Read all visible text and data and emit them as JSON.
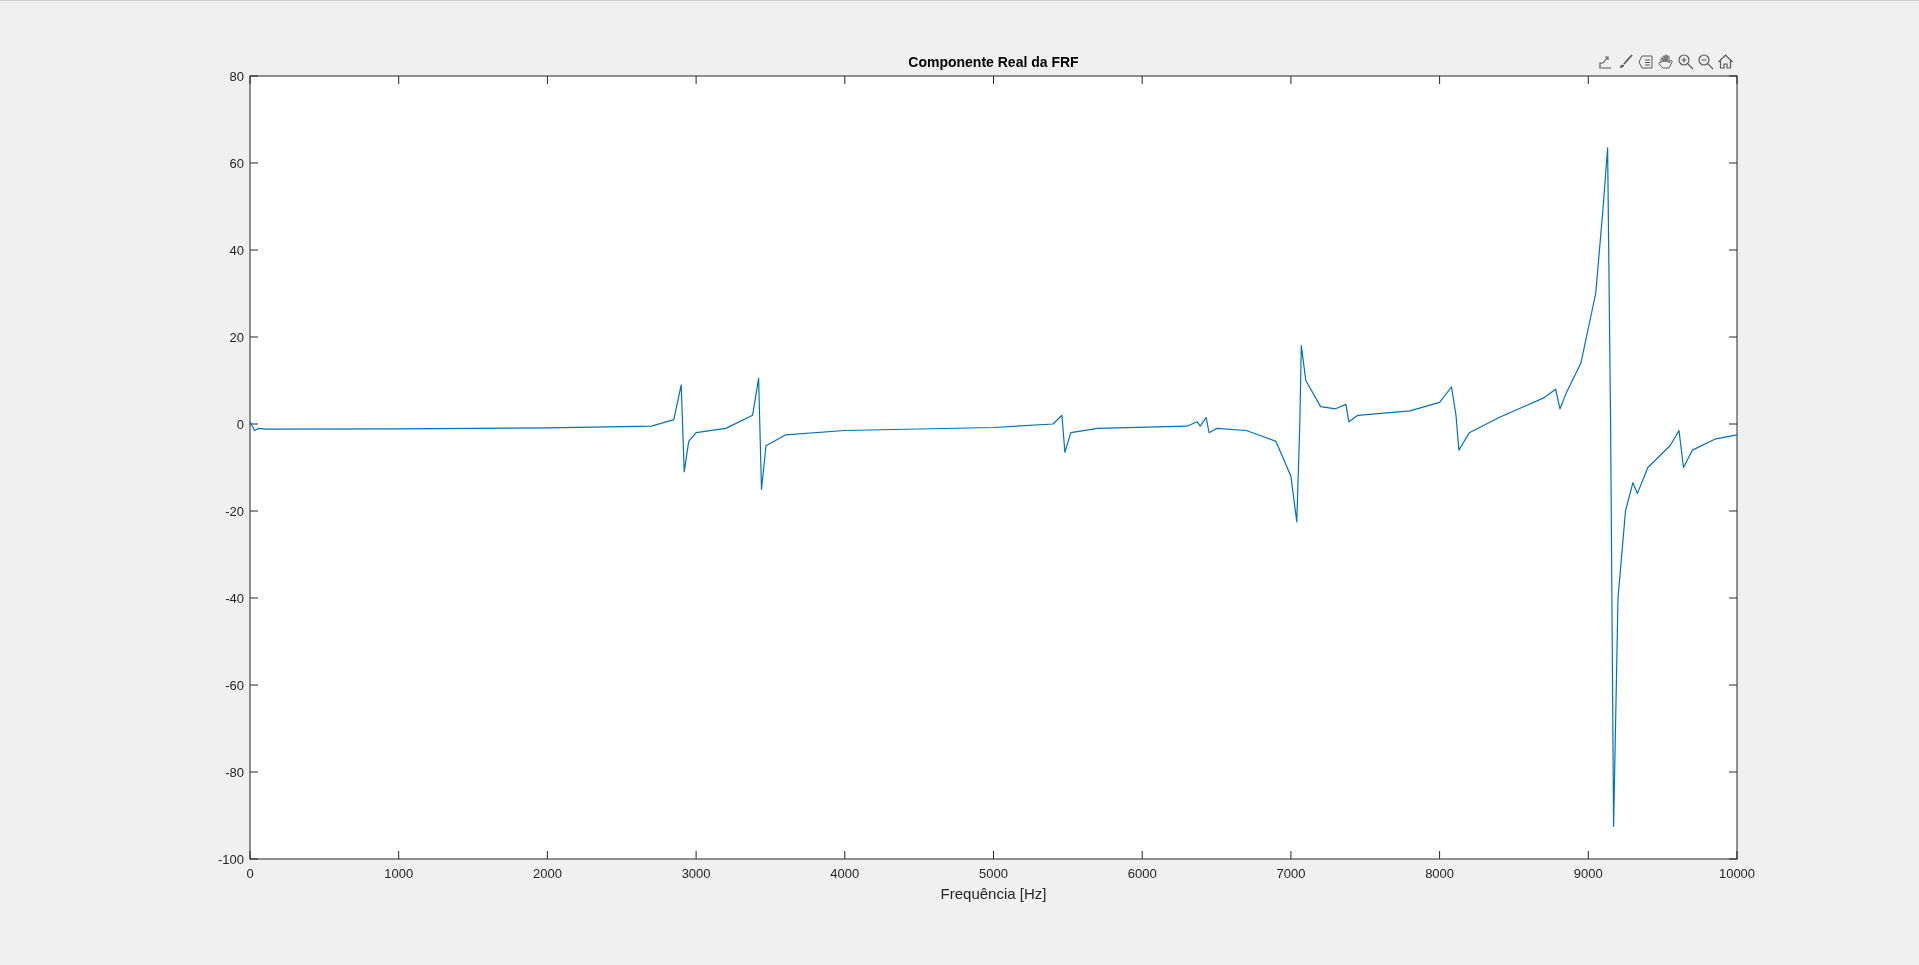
{
  "figure": {
    "chart_data": {
      "type": "line",
      "title": "Componente Real da FRF",
      "xlabel": "Frequência [Hz]",
      "x": [
        0,
        30,
        60,
        100,
        1000,
        2000,
        2700,
        2850,
        2900,
        2920,
        2950,
        3000,
        3200,
        3380,
        3420,
        3440,
        3470,
        3600,
        4000,
        5000,
        5400,
        5460,
        5480,
        5520,
        5700,
        6300,
        6370,
        6390,
        6430,
        6450,
        6500,
        6700,
        6900,
        7000,
        7040,
        7060,
        7070,
        7100,
        7200,
        7300,
        7370,
        7390,
        7450,
        7800,
        8000,
        8080,
        8110,
        8130,
        8200,
        8400,
        8700,
        8780,
        8810,
        8850,
        8950,
        9050,
        9100,
        9130,
        9150,
        9170,
        9200,
        9250,
        9300,
        9330,
        9400,
        9550,
        9610,
        9640,
        9700,
        9850,
        10000
      ],
      "series": [
        {
          "color": "#0072bd",
          "values": [
            0.5,
            -1.5,
            -1,
            -1.2,
            -1.1,
            -0.9,
            -0.5,
            1,
            9,
            -11,
            -4,
            -2,
            -1,
            2,
            10.5,
            -15,
            -5,
            -2.5,
            -1.5,
            -0.8,
            0,
            2,
            -6.5,
            -2,
            -1,
            -0.5,
            0.5,
            -0.5,
            1.5,
            -2,
            -1,
            -1.5,
            -4,
            -12,
            -22.5,
            0,
            18,
            10,
            4,
            3.5,
            4.5,
            0.5,
            2,
            3,
            5,
            8.5,
            2,
            -6,
            -2,
            1.5,
            6,
            8,
            3.5,
            7,
            14,
            30,
            50,
            63.5,
            0,
            -92.5,
            -40,
            -20,
            -13.5,
            -16,
            -10,
            -5,
            -1.5,
            -10,
            -6,
            -3.5,
            -2.5
          ]
        }
      ],
      "xlim": [
        0,
        10000
      ],
      "ylim": [
        -100,
        80
      ],
      "xticks": [
        0,
        1000,
        2000,
        3000,
        4000,
        5000,
        6000,
        7000,
        8000,
        9000,
        10000
      ],
      "yticks": [
        -100,
        -80,
        -60,
        -40,
        -20,
        0,
        20,
        40,
        60,
        80
      ]
    }
  }
}
